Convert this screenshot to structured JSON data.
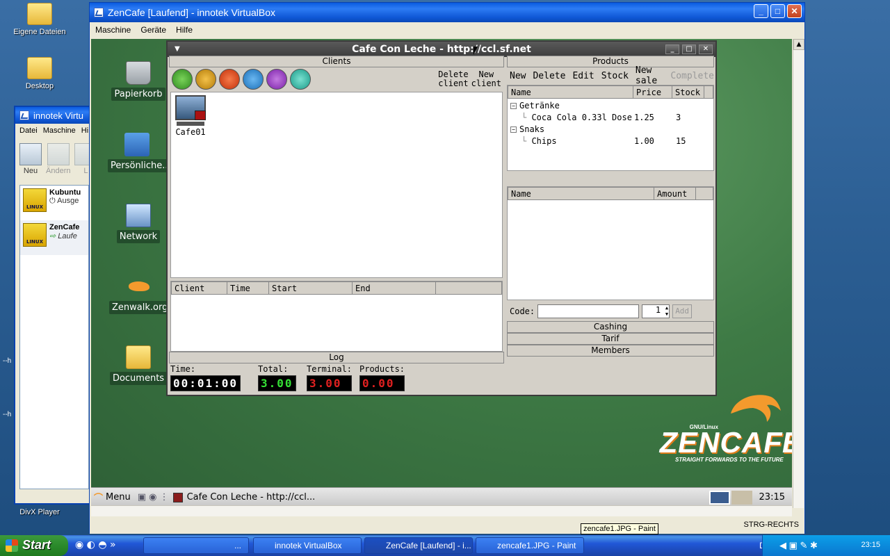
{
  "xp_desktop": {
    "icons": [
      {
        "label": "Eigene Dateien",
        "icon": "folder-documents-icon"
      },
      {
        "label": "Desktop",
        "icon": "folder-icon"
      },
      {
        "label": "DivX Player",
        "icon": "divx-icon"
      }
    ]
  },
  "vbox_manager": {
    "title": "innotek Virtu",
    "menu": [
      "Datei",
      "Maschine",
      "Hi"
    ],
    "toolbar": [
      {
        "label": "Neu"
      },
      {
        "label": "Ändern"
      },
      {
        "label": "L"
      }
    ],
    "vms": [
      {
        "name": "Kubuntu",
        "state": "Ausge"
      },
      {
        "name": "ZenCafe",
        "state": "Laufe"
      }
    ]
  },
  "vbox_window": {
    "title": "ZenCafe [Laufend] - innotek VirtualBox",
    "menu": [
      "Maschine",
      "Geräte",
      "Hilfe"
    ],
    "host_key": "STRG-RECHTS"
  },
  "guest_desktop": {
    "icons": [
      {
        "label": "Papierkorb"
      },
      {
        "label": "Persönliche..."
      },
      {
        "label": "Network"
      },
      {
        "label": "Zenwalk.org"
      },
      {
        "label": "Documents"
      }
    ]
  },
  "ccl": {
    "title": "Cafe Con Leche - http://ccl.sf.net",
    "clients_header": "Clients",
    "delete_client": [
      "Delete",
      "client"
    ],
    "new_client": [
      "New",
      "client"
    ],
    "client_items": [
      {
        "name": "Cafe01"
      }
    ],
    "session_columns": [
      "Client",
      "Time",
      "Start",
      "End",
      ""
    ],
    "log_header": "Log",
    "stats": {
      "time_label": "Time:",
      "time_value": "00:01:00",
      "total_label": "Total:",
      "total_value": "3.00",
      "terminal_label": "Terminal:",
      "terminal_value": "3.00",
      "products_label": "Products:",
      "products_value": "0.00"
    },
    "products_header": "Products",
    "product_actions": [
      "New",
      "Delete",
      "Edit",
      "Stock",
      "New sale",
      "Complete"
    ],
    "product_columns": [
      "Name",
      "Price",
      "Stock"
    ],
    "product_tree": [
      {
        "category": "Getränke",
        "items": [
          {
            "name": "Coca Cola 0.33l Dose",
            "price": "1.25",
            "stock": "3"
          }
        ]
      },
      {
        "category": "Snaks",
        "items": [
          {
            "name": "Chips",
            "price": "1.00",
            "stock": "15"
          }
        ]
      }
    ],
    "sale_columns": [
      "Name",
      "Amount",
      ""
    ],
    "code_label": "Code:",
    "quantity": "1",
    "add_label": "Add",
    "sections": [
      "Cashing",
      "Tarif",
      "Members"
    ]
  },
  "zencafe_logo": {
    "small": "GNU/Linux",
    "big": "ZENCAFE",
    "slogan": "STRAIGHT FORWARDS TO THE FUTURE"
  },
  "guest_taskbar": {
    "menu": "Menu",
    "task": "Cafe Con Leche - http://ccl...",
    "clock": "23:15"
  },
  "tooltip": "zencafe1.JPG - Paint",
  "xp_taskbar": {
    "start": "Start",
    "tasks": [
      {
        "label": "..."
      },
      {
        "label": "innotek VirtualBox"
      },
      {
        "label": "ZenCafe [Laufend] - i..."
      },
      {
        "label": "zencafe1.JPG - Paint"
      }
    ],
    "lang": "DE",
    "clock": "23:15"
  },
  "colors": {
    "stat_time": "#ffffff",
    "stat_total": "#35e035",
    "stat_terminal": "#e02020",
    "stat_products": "#e02020"
  }
}
